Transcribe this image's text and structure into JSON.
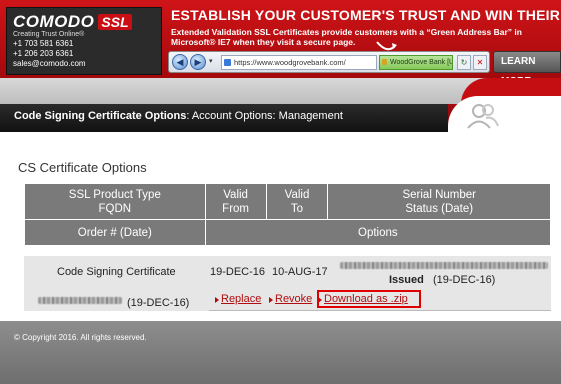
{
  "banner": {
    "logo": "COMODO",
    "logo_badge": "SSL",
    "tagline": "Creating Trust Online®",
    "phone1": "+1 703 581 6361",
    "phone2": "+1 206 203 6361",
    "email": "sales@comodo.com",
    "headline": "ESTABLISH YOUR CUSTOMER'S TRUST AND WIN THEIR B",
    "subline": "Extended Validation SSL Certificates provide customers with a “Green Address Bar” in Microsoft® IE7 when they visit a secure page.",
    "browser_url": "https://www.woodgrovebank.com/",
    "green_address": "WoodGrove Bank [US]",
    "learn_more": "LEARN MORE"
  },
  "breadcrumb": {
    "bold": "Code Signing Certificate Options",
    "rest": ": Account Options: Management"
  },
  "page": {
    "section_title": "CS Certificate Options"
  },
  "table": {
    "headers_row1": [
      {
        "line1": "SSL Product Type",
        "line2": "FQDN"
      },
      {
        "line1": "Valid",
        "line2": "From"
      },
      {
        "line1": "Valid",
        "line2": "To"
      },
      {
        "line1": "Serial Number",
        "line2": "Status  (Date)"
      }
    ],
    "headers_row2": [
      "Order #  (Date)",
      "Options"
    ],
    "row": {
      "product": "Code Signing Certificate",
      "valid_from": "19-DEC-16",
      "valid_to": "10-AUG-17",
      "status": "Issued",
      "status_date": "(19-DEC-16)",
      "order_date": "(19-DEC-16)",
      "options": [
        "Replace",
        "Revoke",
        "Download as .zip"
      ]
    }
  },
  "footer": {
    "copyright": "© Copyright 2016. All rights reserved."
  }
}
